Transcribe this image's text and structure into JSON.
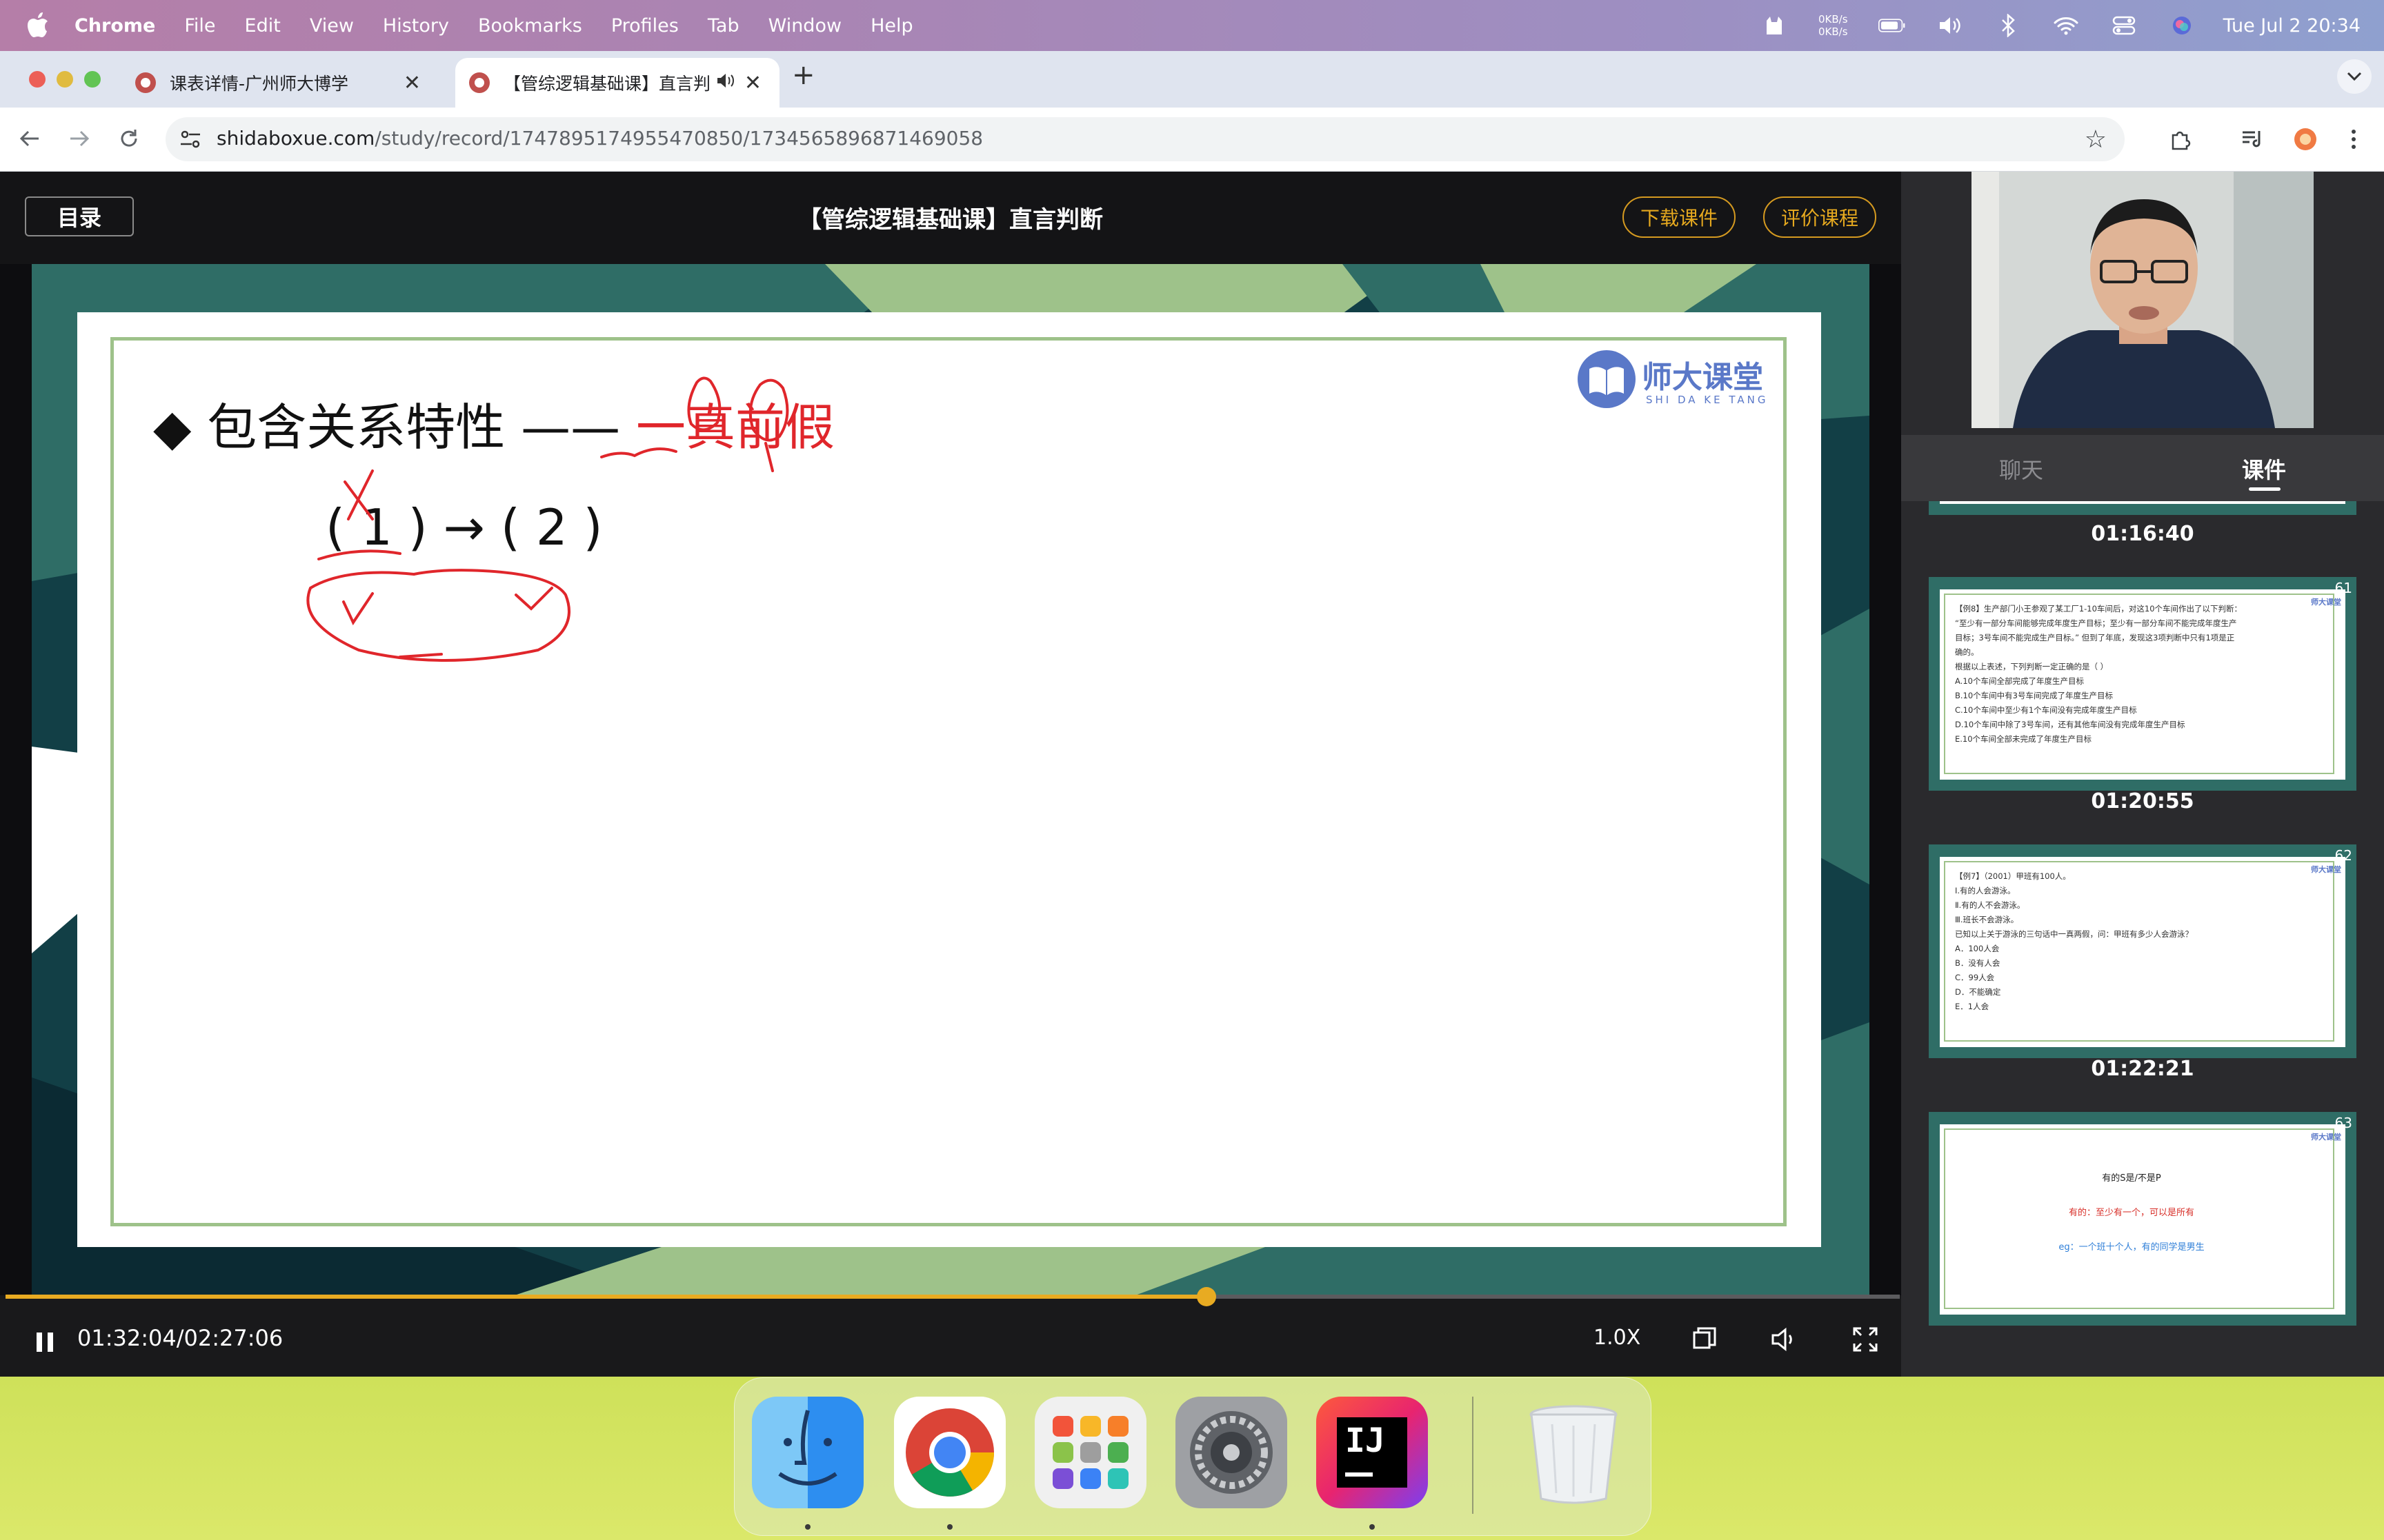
{
  "menubar": {
    "app_name": "Chrome",
    "items": [
      "File",
      "Edit",
      "View",
      "History",
      "Bookmarks",
      "Profiles",
      "Tab",
      "Window",
      "Help"
    ],
    "net_up": "0KB/s",
    "net_down": "0KB/s",
    "clock": "Tue Jul 2  20:34"
  },
  "tabs": [
    {
      "title": "课表详情-广州师大博学",
      "active": false
    },
    {
      "title": "【管综逻辑基础课】直言判",
      "active": true,
      "audio": true
    }
  ],
  "address_bar": {
    "host": "shidaboxue.com",
    "path": "/study/record/1747895174955470850/1734565896871469058"
  },
  "player": {
    "menu_label": "目录",
    "title": "【管综逻辑基础课】直言判断",
    "download_label": "下载课件",
    "rate_label": "评价课程",
    "slide": {
      "bullet": "◆",
      "heading": "包含关系特性 —— ",
      "heading_red": "一真前假",
      "formula": "( 1 ) → ( 2 )",
      "logo_text": "师大课堂",
      "logo_sub": "SHI DA KE TANG"
    },
    "time_display": "01:32:04/02:27:06",
    "progress": 0.634,
    "speed": "1.0X"
  },
  "sidebar": {
    "tabs": [
      "聊天",
      "课件"
    ],
    "active_tab": "课件",
    "timestamps": [
      "01:16:40",
      "01:20:55",
      "01:22:21"
    ],
    "thumbnails": [
      {
        "num": "61",
        "lines": [
          "【例8】生产部门小王参观了某工厂1-10车间后，对这10个车间作出了以下判断：",
          "“至少有一部分车间能够完成年度生产目标；至少有一部分车间不能完成年度生产",
          "目标；3号车间不能完成生产目标。” 但到了年底，发现这3项判断中只有1项是正",
          "确的。",
          "根据以上表述，下列判断一定正确的是（     ）",
          "A.10个车间全部完成了年度生产目标",
          "B.10个车间中有3号车间完成了年度生产目标",
          "C.10个车间中至少有1个车间没有完成年度生产目标",
          "D.10个车间中除了3号车间，还有其他车间没有完成年度生产目标",
          "E.10个车间全部未完成了年度生产目标"
        ]
      },
      {
        "num": "62",
        "lines": [
          "【例7】（2001）甲班有100人。",
          "Ⅰ.有的人会游泳。",
          "Ⅱ.有的人不会游泳。",
          "Ⅲ.班长不会游泳。",
          "已知以上关于游泳的三句话中一真两假，问：甲班有多少人会游泳？",
          "A．100人会",
          "B．没有人会",
          "C．99人会",
          "D．不能确定",
          "E．1人会"
        ]
      },
      {
        "num": "63",
        "lines": [
          "有的S是/不是P",
          "有的：至少有一个，可以是所有",
          "eg：一个班十个人，有的同学是男生"
        ]
      }
    ]
  },
  "dock": {
    "apps": [
      "finder",
      "chrome",
      "launchpad",
      "system-settings",
      "intellij-idea",
      "trash"
    ],
    "idea_label": "IJ"
  },
  "colors": {
    "accent_orange": "#e8ab22",
    "slide_red": "#e0262b",
    "slide_green": "#9ec28a",
    "slide_teal": "#2f6d66"
  }
}
